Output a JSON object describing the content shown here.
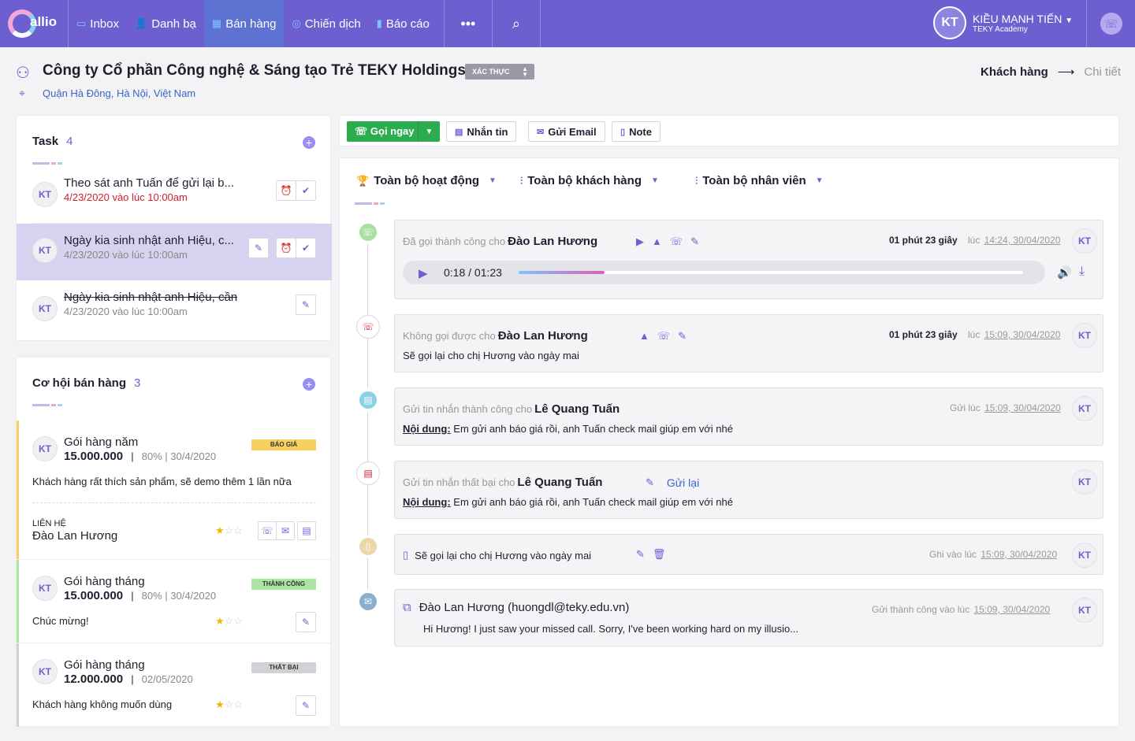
{
  "nav": {
    "logo": "allio",
    "items": [
      {
        "label": "Inbox",
        "icon": "inbox-icon"
      },
      {
        "label": "Danh bạ",
        "icon": "contacts-icon"
      },
      {
        "label": "Bán hàng",
        "icon": "sales-icon"
      },
      {
        "label": "Chiến dịch",
        "icon": "campaign-icon"
      },
      {
        "label": "Báo cáo",
        "icon": "report-icon"
      }
    ],
    "more": "•••",
    "user": {
      "initials": "KT",
      "name": "KIỀU MẠNH TIẾN",
      "org": "TEKY Academy"
    }
  },
  "header": {
    "title": "Công ty Cổ phần Công nghệ & Sáng tạo Trẻ TEKY Holdings",
    "badge": "XÁC THỰC",
    "location": "Quận Hà Đông, Hà Nội, Việt Nam",
    "breadcrumb": {
      "current": "Khách hàng",
      "next": "Chi tiết"
    }
  },
  "tasks": {
    "title": "Task",
    "count": "4",
    "items": [
      {
        "avatar": "KT",
        "title": "Theo sát anh Tuấn để gửi lại b...",
        "date": "4/23/2020 vào lúc 10:00am"
      },
      {
        "avatar": "KT",
        "title": "Ngày kia sinh nhật anh Hiệu, c...",
        "date": "4/23/2020 vào lúc 10:00am"
      },
      {
        "avatar": "KT",
        "title": "Ngày kia sinh nhật anh Hiệu, cần mu...",
        "date": "4/23/2020 vào lúc 10:00am"
      }
    ]
  },
  "opportunities": {
    "title": "Cơ hội bán hàng",
    "count": "3",
    "contact_label": "LIÊN HỆ",
    "items": [
      {
        "avatar": "KT",
        "name": "Gói hàng năm",
        "amount": "15.000.000",
        "sep": "|",
        "meta": "80% | 30/4/2020",
        "tag": "BÁO GIÁ",
        "tag_color": "#f7d060",
        "bar_color": "#f7d060",
        "desc": "Khách hàng rất thích sản phẩm, sẽ demo thêm 1 lần nữa",
        "contact": "Đào Lan Hương",
        "stars": "★",
        "stars_empty": "☆☆"
      },
      {
        "avatar": "KT",
        "name": "Gói hàng tháng",
        "amount": "15.000.000",
        "sep": "|",
        "meta": "80% | 30/4/2020",
        "tag": "THÀNH CÔNG",
        "tag_color": "#a9e6a0",
        "bar_color": "#a9e6a0",
        "desc": "Chúc mừng!",
        "stars": "★",
        "stars_empty": "☆☆"
      },
      {
        "avatar": "KT",
        "name": "Gói hàng tháng",
        "amount": "12.000.000",
        "sep": "|",
        "meta": "02/05/2020",
        "tag": "THẤT BẠI",
        "tag_color": "#d0d0d6",
        "bar_color": "#d0d0d6",
        "desc": "Khách hàng không muốn dùng",
        "stars": "★",
        "stars_empty": "☆☆"
      }
    ]
  },
  "toolbar": {
    "call": "Gọi ngay",
    "message": "Nhắn tin",
    "email": "Gửi Email",
    "note": "Note"
  },
  "filters": {
    "activity": "Toàn bộ hoạt động",
    "customer": "Toàn bộ khách hàng",
    "staff": "Toàn bộ nhân viên"
  },
  "timeline": [
    {
      "type": "call-success",
      "prefix": "Đã gọi thành công cho",
      "name": "Đào Lan Hương",
      "duration": "01 phút 23 giây",
      "when_prefix": "lúc",
      "when": "14:24, 30/04/2020",
      "avatar": "KT",
      "player_time": "0:18 / 01:23",
      "progress": 0.17
    },
    {
      "type": "call-failed",
      "prefix": "Không gọi được cho",
      "name": "Đào Lan Hương",
      "duration": "01 phút 23 giây",
      "when_prefix": "lúc",
      "when": "15:09, 30/04/2020",
      "avatar": "KT",
      "body": "Sẽ gọi lại cho chị Hương vào ngày mai"
    },
    {
      "type": "sms-success",
      "prefix": "Gửi tin nhắn thành công cho",
      "name": "Lê Quang Tuấn",
      "when_prefix": "Gửi lúc",
      "when": "15:09, 30/04/2020",
      "avatar": "KT",
      "body_label": "Nội dung:",
      "body": "Em gửi anh báo giá rồi, anh Tuấn check mail giúp em với nhé"
    },
    {
      "type": "sms-failed",
      "prefix": "Gửi tin nhắn thất bại cho",
      "name": "Lê Quang Tuấn",
      "resend": "Gửi lại",
      "avatar": "KT",
      "body_label": "Nội dung:",
      "body": "Em gửi anh báo giá rồi, anh Tuấn check mail giúp em với nhé"
    },
    {
      "type": "note",
      "body": "Sẽ gọi lại cho chị Hương vào ngày mai",
      "when_prefix": "Ghi vào lúc",
      "when": "15:09, 30/04/2020",
      "avatar": "KT"
    },
    {
      "type": "email",
      "name": "Đào Lan Hương (huongdl@teky.edu.vn)",
      "when_prefix": "Gửi thành công vào lúc",
      "when": "15:09, 30/04/2020",
      "avatar": "KT",
      "body": "Hi Hương! I just saw your missed call. Sorry, I've been working hard on my illusio..."
    }
  ]
}
